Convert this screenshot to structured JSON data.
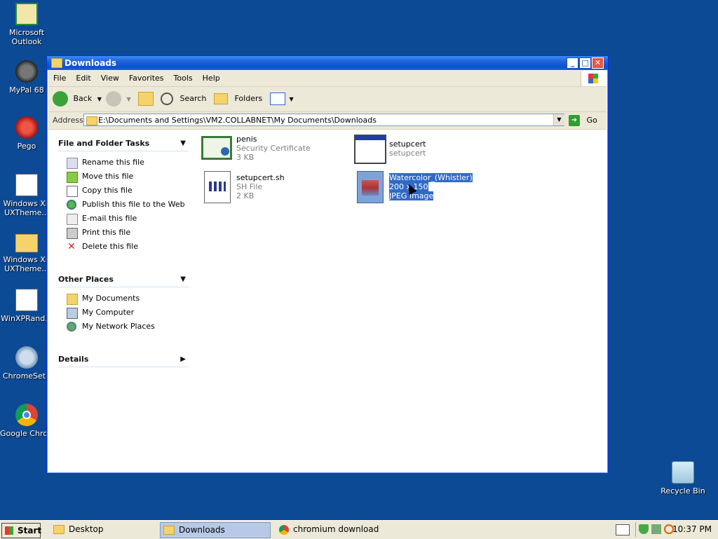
{
  "desktop_icons": [
    {
      "label": "Microsoft Outlook",
      "icon": "outlook-icon"
    },
    {
      "label": "MyPal 68",
      "icon": "mypal-icon"
    },
    {
      "label": "Pego",
      "icon": "pego-icon"
    },
    {
      "label": "Windows XP UXTheme...",
      "icon": "exe-icon"
    },
    {
      "label": "Windows XP UXTheme...",
      "icon": "folder-icon"
    },
    {
      "label": "WinXPRand...",
      "icon": "exe-icon"
    },
    {
      "label": "ChromeSetu",
      "icon": "setup-icon"
    },
    {
      "label": "Google Chrom",
      "icon": "chrome-icon"
    },
    {
      "label": "Recycle Bin",
      "icon": "recycle-bin-icon"
    }
  ],
  "window": {
    "title": "Downloads",
    "menu": [
      "File",
      "Edit",
      "View",
      "Favorites",
      "Tools",
      "Help"
    ],
    "toolbar": {
      "back": "Back",
      "search": "Search",
      "folders": "Folders"
    },
    "address": {
      "label": "Address",
      "value": "E:\\Documents and Settings\\VM2.COLLABNET\\My Documents\\Downloads",
      "go": "Go"
    }
  },
  "left_pane": {
    "file_tasks": {
      "title": "File and Folder Tasks",
      "items": [
        {
          "label": "Rename this file",
          "icon": "rename-icon"
        },
        {
          "label": "Move this file",
          "icon": "move-icon"
        },
        {
          "label": "Copy this file",
          "icon": "copy-icon"
        },
        {
          "label": "Publish this file to the Web",
          "icon": "publish-web-icon"
        },
        {
          "label": "E-mail this file",
          "icon": "email-icon"
        },
        {
          "label": "Print this file",
          "icon": "print-icon"
        },
        {
          "label": "Delete this file",
          "icon": "delete-icon"
        }
      ]
    },
    "other_places": {
      "title": "Other Places",
      "items": [
        {
          "label": "My Documents",
          "icon": "my-documents-icon"
        },
        {
          "label": "My Computer",
          "icon": "my-computer-icon"
        },
        {
          "label": "My Network Places",
          "icon": "network-places-icon"
        }
      ]
    },
    "details": {
      "title": "Details"
    }
  },
  "files": [
    {
      "name": "penis",
      "line2": "Security Certificate",
      "line3": "3 KB",
      "icon": "certificate-icon",
      "selected": false
    },
    {
      "name": "setupcert",
      "line2": "setupcert",
      "line3": "",
      "icon": "window-icon",
      "selected": false
    },
    {
      "name": "setupcert.sh",
      "line2": "SH File",
      "line3": "2 KB",
      "icon": "script-file-icon",
      "selected": false
    },
    {
      "name": "Watercolor_(Whistler)",
      "line2": "200 x 150",
      "line3": "JPEG Image",
      "icon": "jpeg-image-icon",
      "selected": true
    }
  ],
  "taskbar": {
    "start": "Start",
    "buttons": [
      {
        "label": "Desktop",
        "active": false
      },
      {
        "label": "Downloads",
        "active": true
      },
      {
        "label": "chromium download - ...",
        "active": false
      }
    ],
    "clock": "10:37 PM"
  },
  "colors": {
    "desktop": "#0d4a95",
    "titlebar": "#1f5fd6",
    "selection": "#316ac5",
    "chrome": "#ece9d8"
  }
}
